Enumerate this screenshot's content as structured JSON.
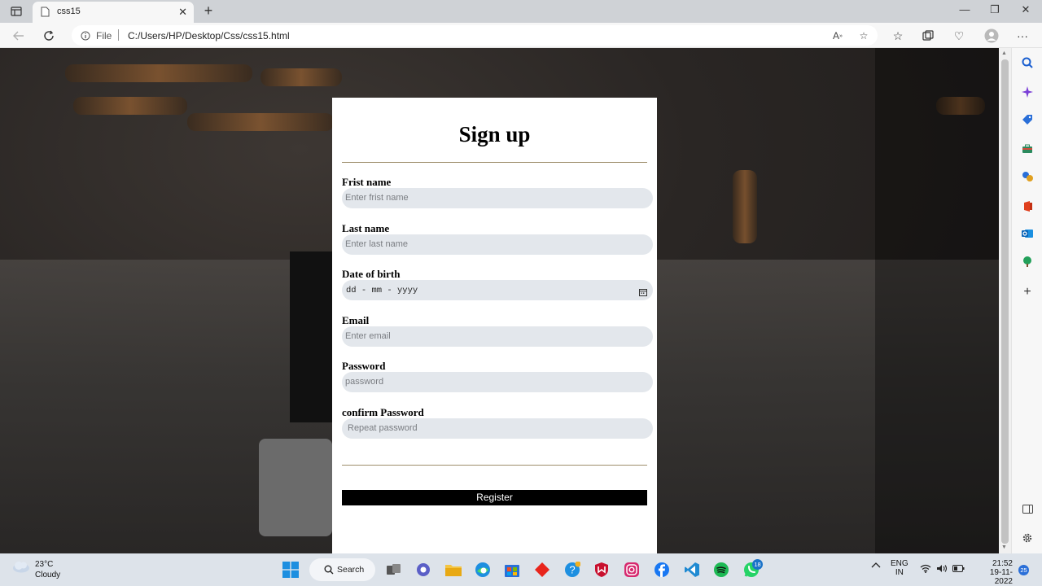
{
  "browser": {
    "tab_title": "css15",
    "url_scheme_label": "File",
    "url": "C:/Users/HP/Desktop/Css/css15.html"
  },
  "form": {
    "title": "Sign up",
    "fields": [
      {
        "label": "Frist name",
        "placeholder": "Enter frist name"
      },
      {
        "label": "Last name",
        "placeholder": "Enter last name"
      },
      {
        "label": "Date of birth",
        "placeholder": "dd - mm - yyyy"
      },
      {
        "label": "Email",
        "placeholder": "Enter email"
      },
      {
        "label": "Password",
        "placeholder": "password"
      },
      {
        "label": "confirm Password",
        "placeholder": "Repeat password"
      }
    ],
    "submit_label": "Register"
  },
  "taskbar": {
    "weather_temp": "23°C",
    "weather_condition": "Cloudy",
    "search_label": "Search",
    "language": "ENG",
    "region": "IN",
    "time": "21:52",
    "date": "19-11-2022",
    "whatsapp_badge": "18",
    "notification_count": "25"
  },
  "colors": {
    "accent_divider": "#9d8e6c",
    "field_bg": "#e3e7ec",
    "button_bg": "#000000"
  }
}
